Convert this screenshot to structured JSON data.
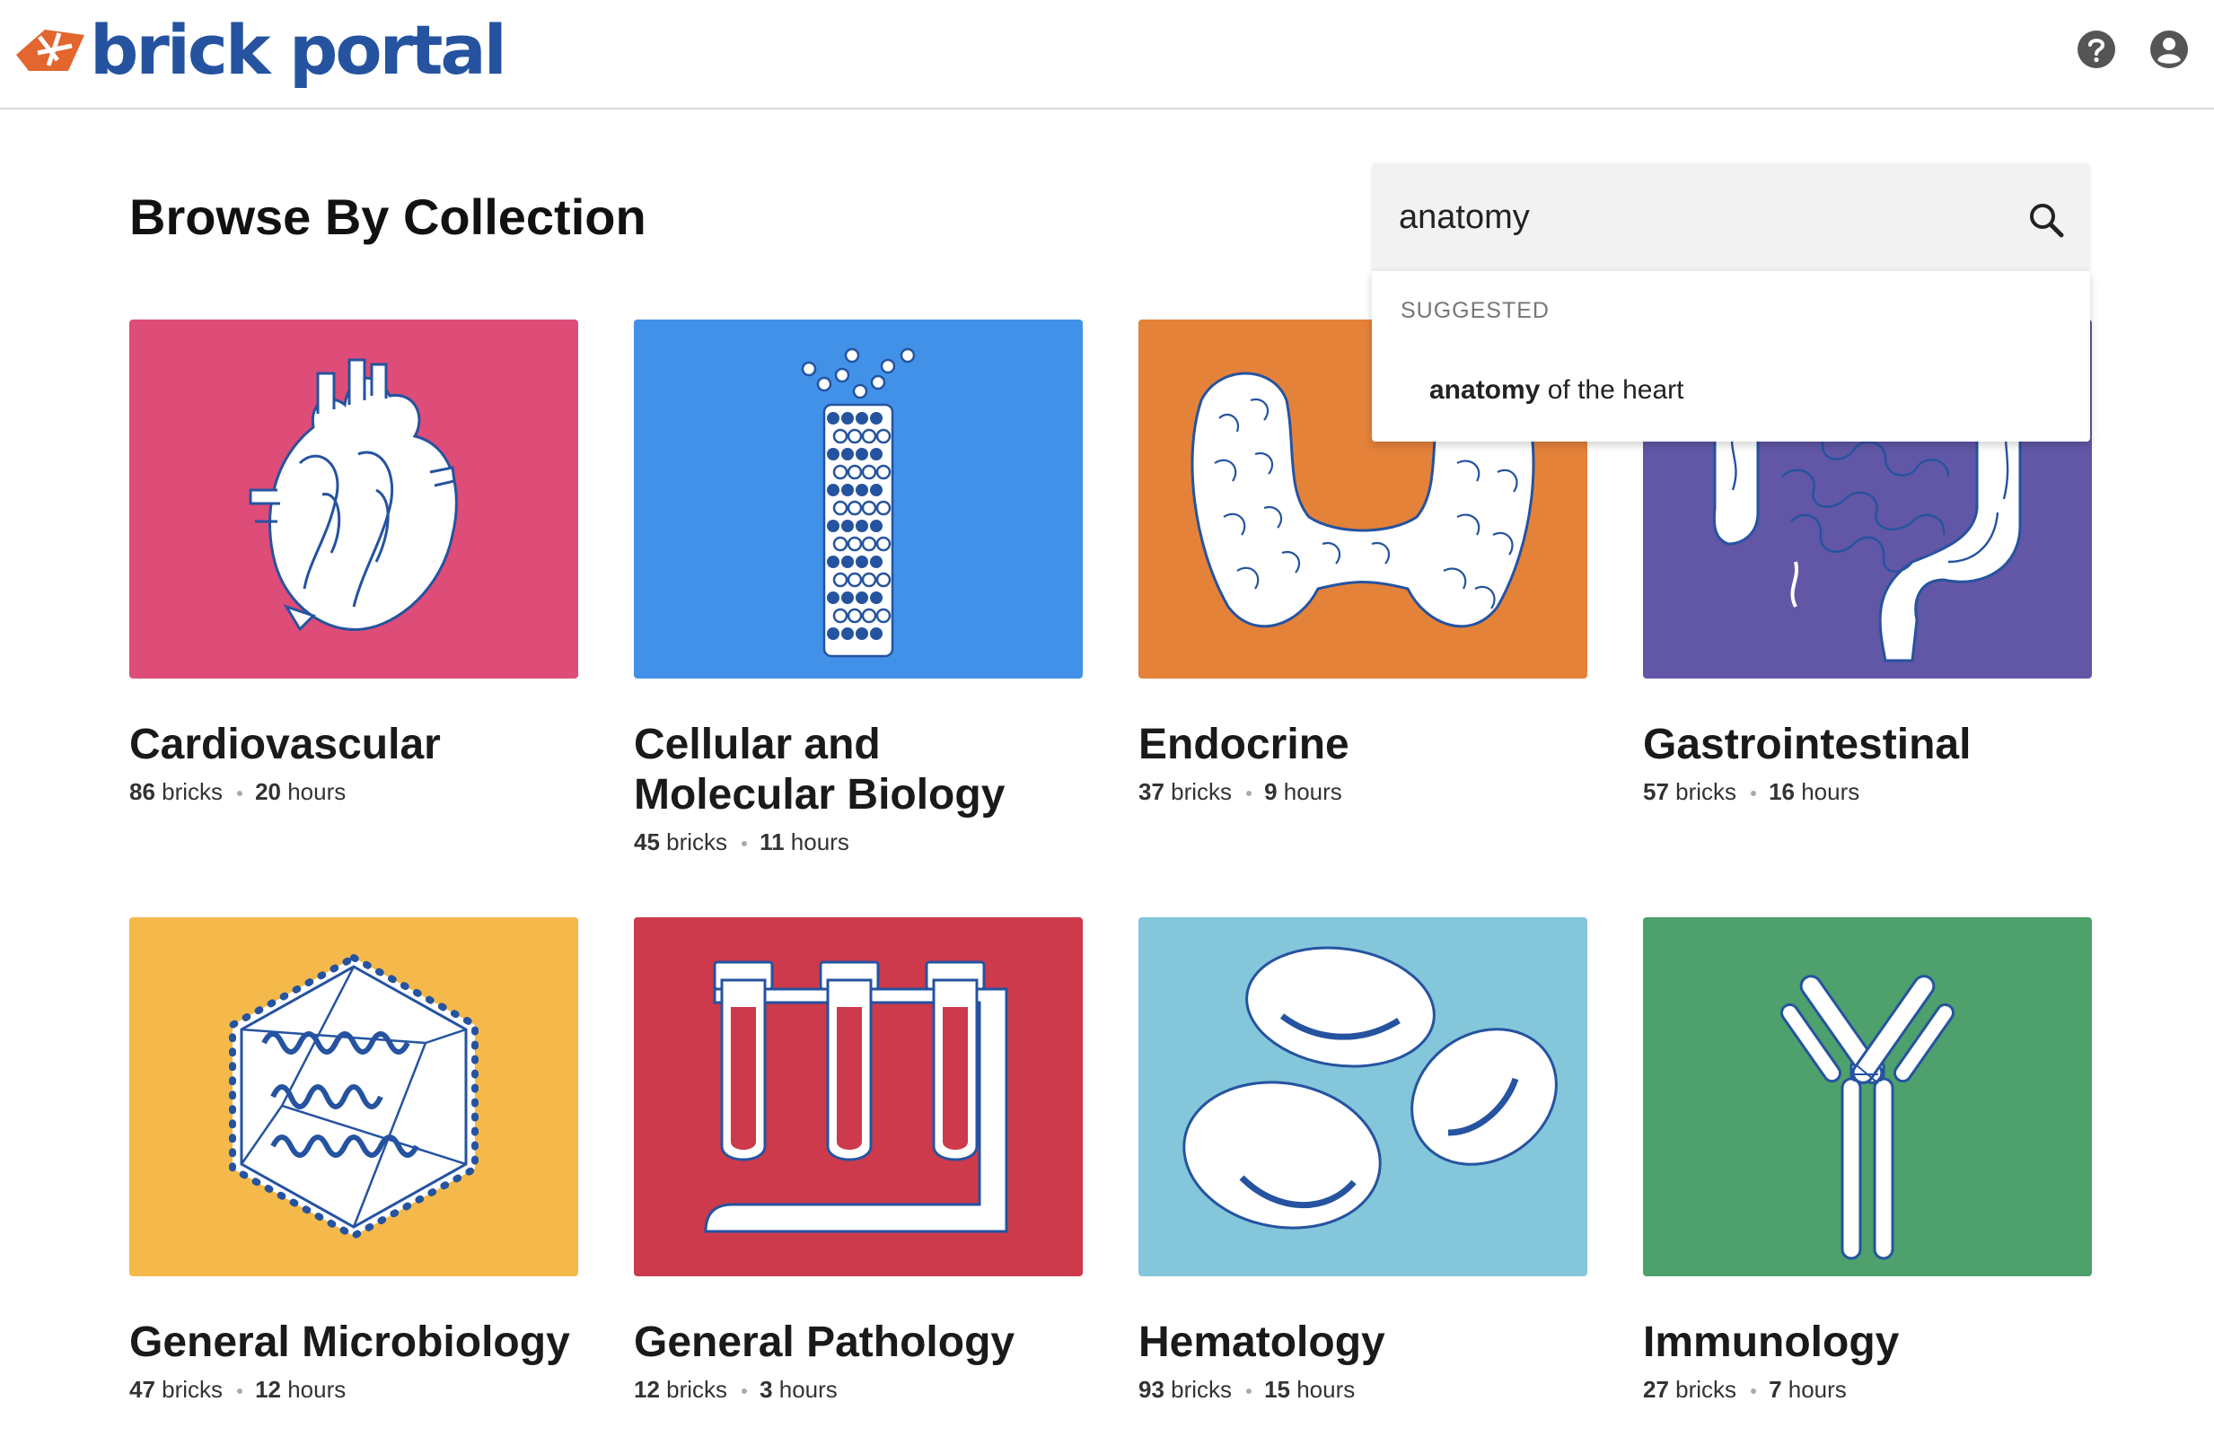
{
  "header": {
    "logo_text": "brick portal",
    "brand_color": "#2553a0",
    "logo_mark_color": "#e2662d",
    "icons": [
      "help-icon",
      "account-icon"
    ]
  },
  "main": {
    "title": "Browse By Collection"
  },
  "search": {
    "value": "anatomy",
    "icon": "search-icon",
    "suggestions": {
      "heading": "SUGGESTED",
      "items": [
        {
          "match": "anatomy",
          "rest": " of the heart"
        }
      ]
    }
  },
  "collections": [
    {
      "name": "Cardiovascular",
      "bricks": "86",
      "bricks_label": "bricks",
      "hours": "20",
      "hours_label": "hours",
      "color": "#de4c78",
      "icon": "heart-icon"
    },
    {
      "name": "Cellular and Molecular Biology",
      "bricks": "45",
      "bricks_label": "bricks",
      "hours": "11",
      "hours_label": "hours",
      "color": "#4191e8",
      "icon": "microtubule-icon"
    },
    {
      "name": "Endocrine",
      "bricks": "37",
      "bricks_label": "bricks",
      "hours": "9",
      "hours_label": "hours",
      "color": "#e5823a",
      "icon": "thyroid-icon"
    },
    {
      "name": "Gastrointestinal",
      "bricks": "57",
      "bricks_label": "bricks",
      "hours": "16",
      "hours_label": "hours",
      "color": "#6157a6",
      "icon": "intestine-icon"
    },
    {
      "name": "General Microbiology",
      "bricks": "47",
      "bricks_label": "bricks",
      "hours": "12",
      "hours_label": "hours",
      "color": "#f4b94a",
      "icon": "virus-icon"
    },
    {
      "name": "General Pathology",
      "bricks": "12",
      "bricks_label": "bricks",
      "hours": "3",
      "hours_label": "hours",
      "color": "#cc3a4c",
      "icon": "test-tubes-icon"
    },
    {
      "name": "Hematology",
      "bricks": "93",
      "bricks_label": "bricks",
      "hours": "15",
      "hours_label": "hours",
      "color": "#84c6da",
      "icon": "red-blood-cells-icon"
    },
    {
      "name": "Immunology",
      "bricks": "27",
      "bricks_label": "bricks",
      "hours": "7",
      "hours_label": "hours",
      "color": "#4ea06c",
      "icon": "antibody-icon"
    }
  ]
}
